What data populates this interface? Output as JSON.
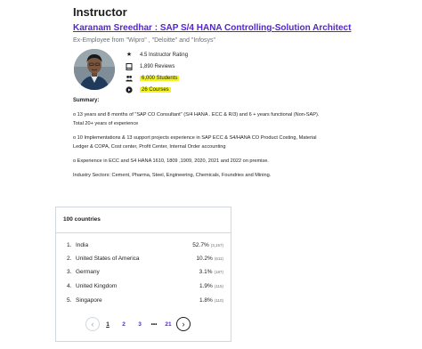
{
  "instructor": {
    "section_title": "Instructor",
    "name": "Karanam Sreedhar : SAP S/4 HANA Controlling-Solution Architect",
    "headline": "Ex-Employee from \"Wipro\" , \"Deloitte\" and \"Infosys\"",
    "stats": [
      {
        "icon": "star-icon",
        "label": "4.5 Instructor Rating"
      },
      {
        "icon": "reviews-icon",
        "label": "1,890 Reviews"
      },
      {
        "icon": "students-icon",
        "label": "6,000 Students"
      },
      {
        "icon": "play-icon",
        "label": "26 Courses"
      }
    ]
  },
  "summary": {
    "title": "Summary:",
    "paragraphs": [
      "o 13 years and 8 months of \"SAP CO Consultant\" (S/4 HANA . ECC & R/3) and 6 + years functional (Non-SAP). Total 20+ years of experience",
      "o 10 Implementations & 13 support projects experience in SAP ECC & S4/HANA CO Product Costing, Material Ledger & COPA, Cost center, Profit Center, Internal Order accounting",
      "o Experience in ECC and S4 HANA 1610, 1809 ,1909, 2020, 2021 and 2022 on premise.",
      "Industry Sectors: Cement, Pharma, Steel, Engineering, Chemicals, Foundries and Mining."
    ]
  },
  "countries": {
    "title": "100 countries",
    "rows": [
      {
        "rank": "1.",
        "name": "India",
        "pct": "52.7%",
        "count": "(3,157)"
      },
      {
        "rank": "2.",
        "name": "United States of America",
        "pct": "10.2%",
        "count": "(611)"
      },
      {
        "rank": "3.",
        "name": "Germany",
        "pct": "3.1%",
        "count": "(187)"
      },
      {
        "rank": "4.",
        "name": "United Kingdom",
        "pct": "1.9%",
        "count": "(115)"
      },
      {
        "rank": "5.",
        "name": "Singapore",
        "pct": "1.8%",
        "count": "(110)"
      }
    ],
    "pagination": {
      "prev": "‹",
      "pages": [
        "1",
        "2",
        "3"
      ],
      "ellipsis": "•••",
      "last": "21",
      "next": "›",
      "active": "1"
    }
  },
  "colors": {
    "link": "#5624d0",
    "highlight": "#f3f324",
    "text": "#1c1d1f",
    "muted": "#6a6f73",
    "border": "#d1d7dc"
  }
}
